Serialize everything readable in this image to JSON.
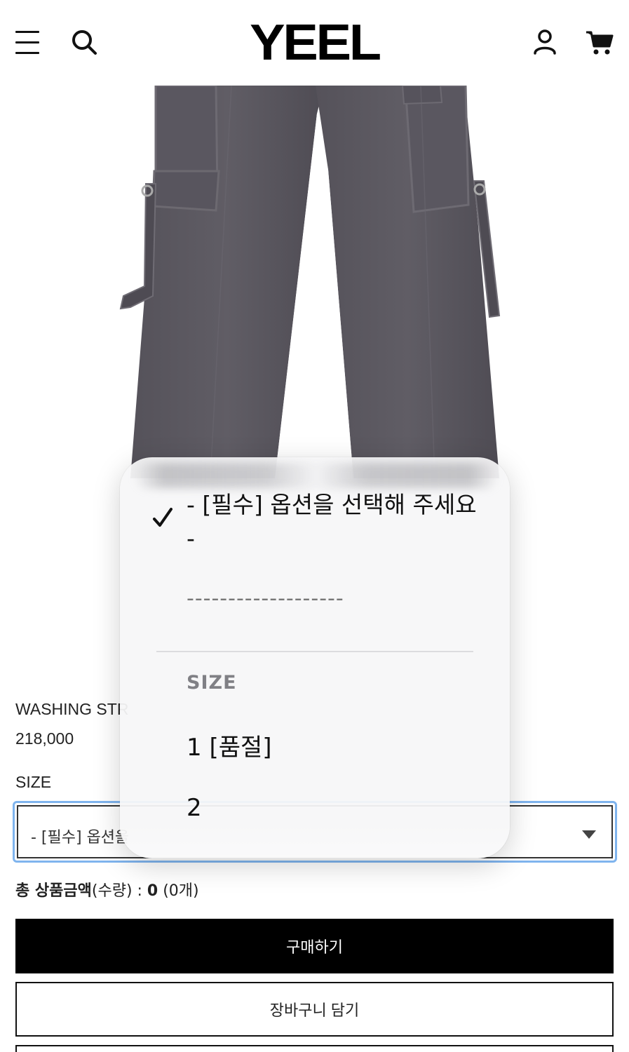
{
  "header": {
    "logo": "YEEL",
    "icons": [
      "hamburger-menu-icon",
      "search-icon",
      "user-icon",
      "cart-icon"
    ]
  },
  "product": {
    "name": "WASHING STR",
    "price": "218,000",
    "size_label": "SIZE",
    "select_value": "- [필수] 옵션을"
  },
  "total": {
    "label": "총 상품금액",
    "qty_label": "(수량) : ",
    "amount": "0",
    "count": " (0개)"
  },
  "buttons": {
    "buy": "구매하기",
    "add_to_cart": "장바구니 담기"
  },
  "dropdown": {
    "selected_option": "- [필수] 옵션을 선택해 주세요 -",
    "divider_option": "-------------------",
    "group_label": "SIZE",
    "options": [
      "1 [품절]",
      "2"
    ]
  },
  "colors": {
    "accent_focus": "#7fb4ee",
    "button_bg": "#000000",
    "popover_bg": "#f6f6f8"
  }
}
